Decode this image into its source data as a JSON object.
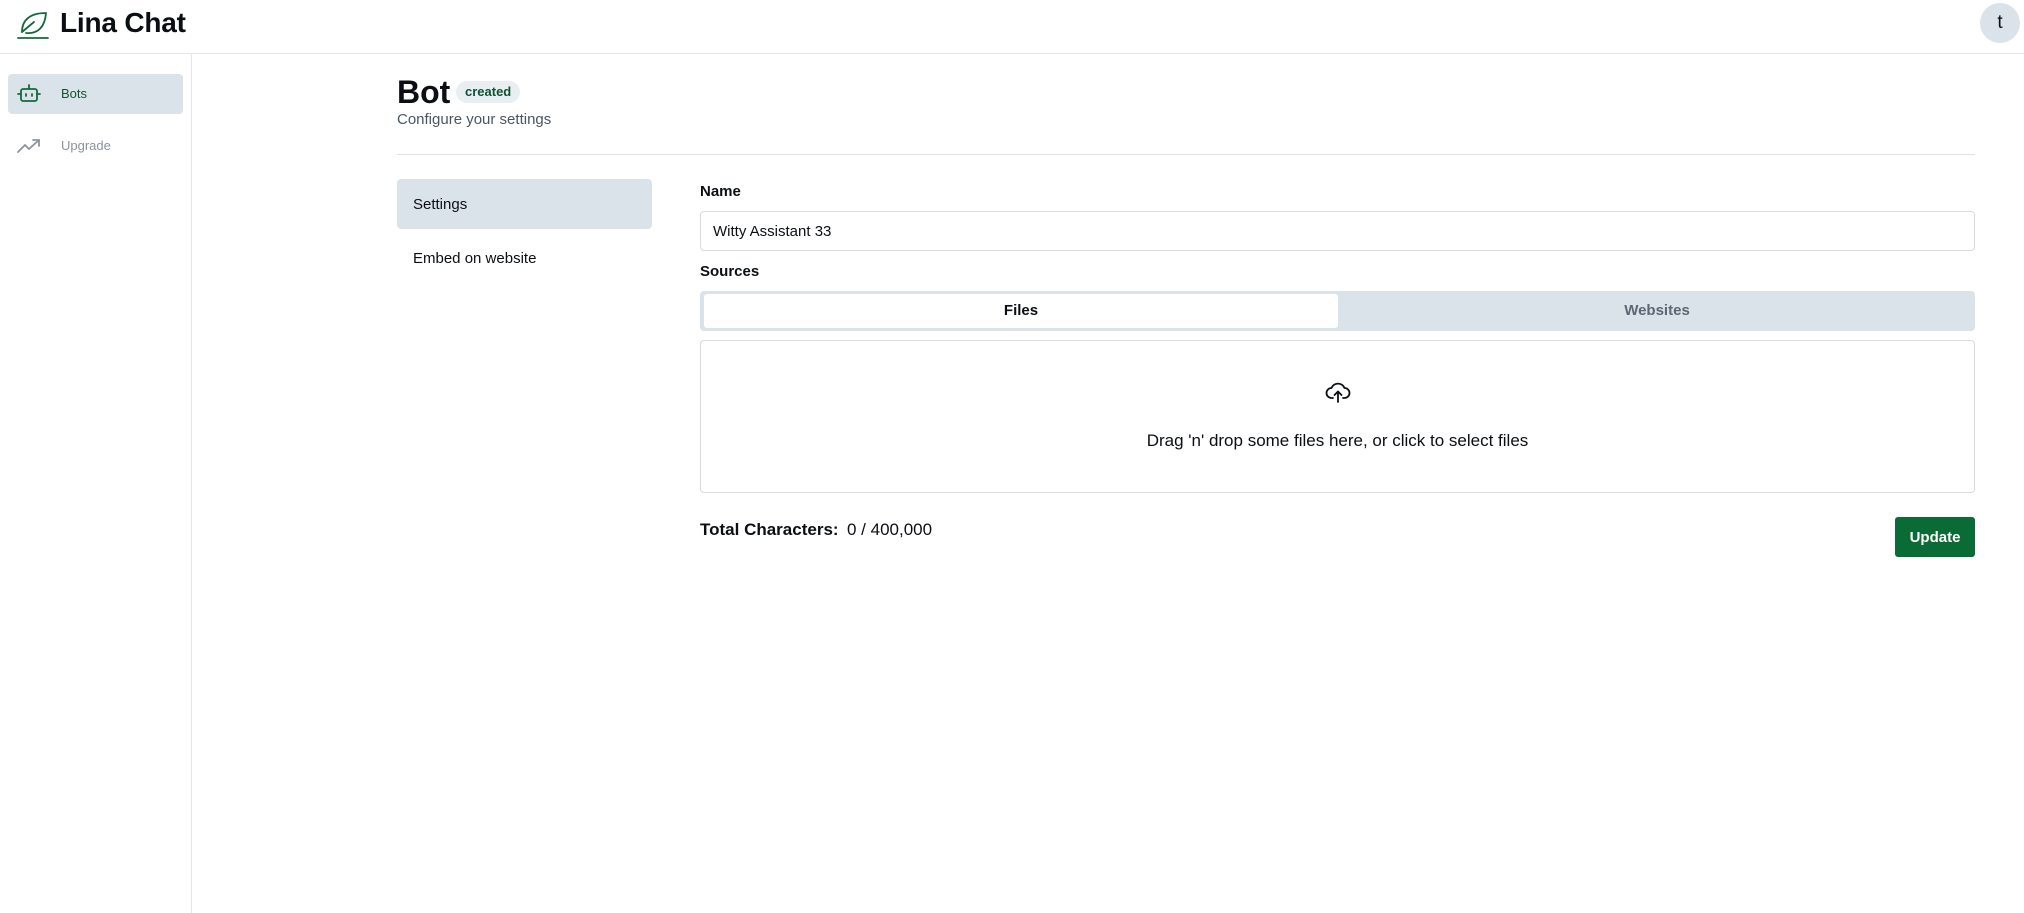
{
  "app": {
    "title": "Lina Chat",
    "logo_icon": "leaf-icon",
    "avatar_initial": "t"
  },
  "sidebar": {
    "items": [
      {
        "label": "Bots",
        "icon": "robot-icon",
        "active": true
      },
      {
        "label": "Upgrade",
        "icon": "trending-up-icon",
        "active": false
      }
    ]
  },
  "page": {
    "title": "Bot",
    "status_badge": "created",
    "subtitle": "Configure your settings"
  },
  "settings_nav": {
    "items": [
      {
        "label": "Settings",
        "active": true
      },
      {
        "label": "Embed on website",
        "active": false
      }
    ]
  },
  "form": {
    "name_label": "Name",
    "name_value": "Witty Assistant 33",
    "sources_label": "Sources",
    "source_tabs": [
      {
        "label": "Files",
        "active": true
      },
      {
        "label": "Websites",
        "active": false
      }
    ],
    "dropzone_icon": "cloud-upload-icon",
    "dropzone_text": "Drag 'n' drop some files here, or click to select files",
    "total_label": "Total Characters:",
    "total_value": "0 / 400,000",
    "update_label": "Update"
  },
  "colors": {
    "accent": "#0b6b35",
    "active_bg": "#dbe3ea",
    "badge_text": "#0f5132"
  }
}
